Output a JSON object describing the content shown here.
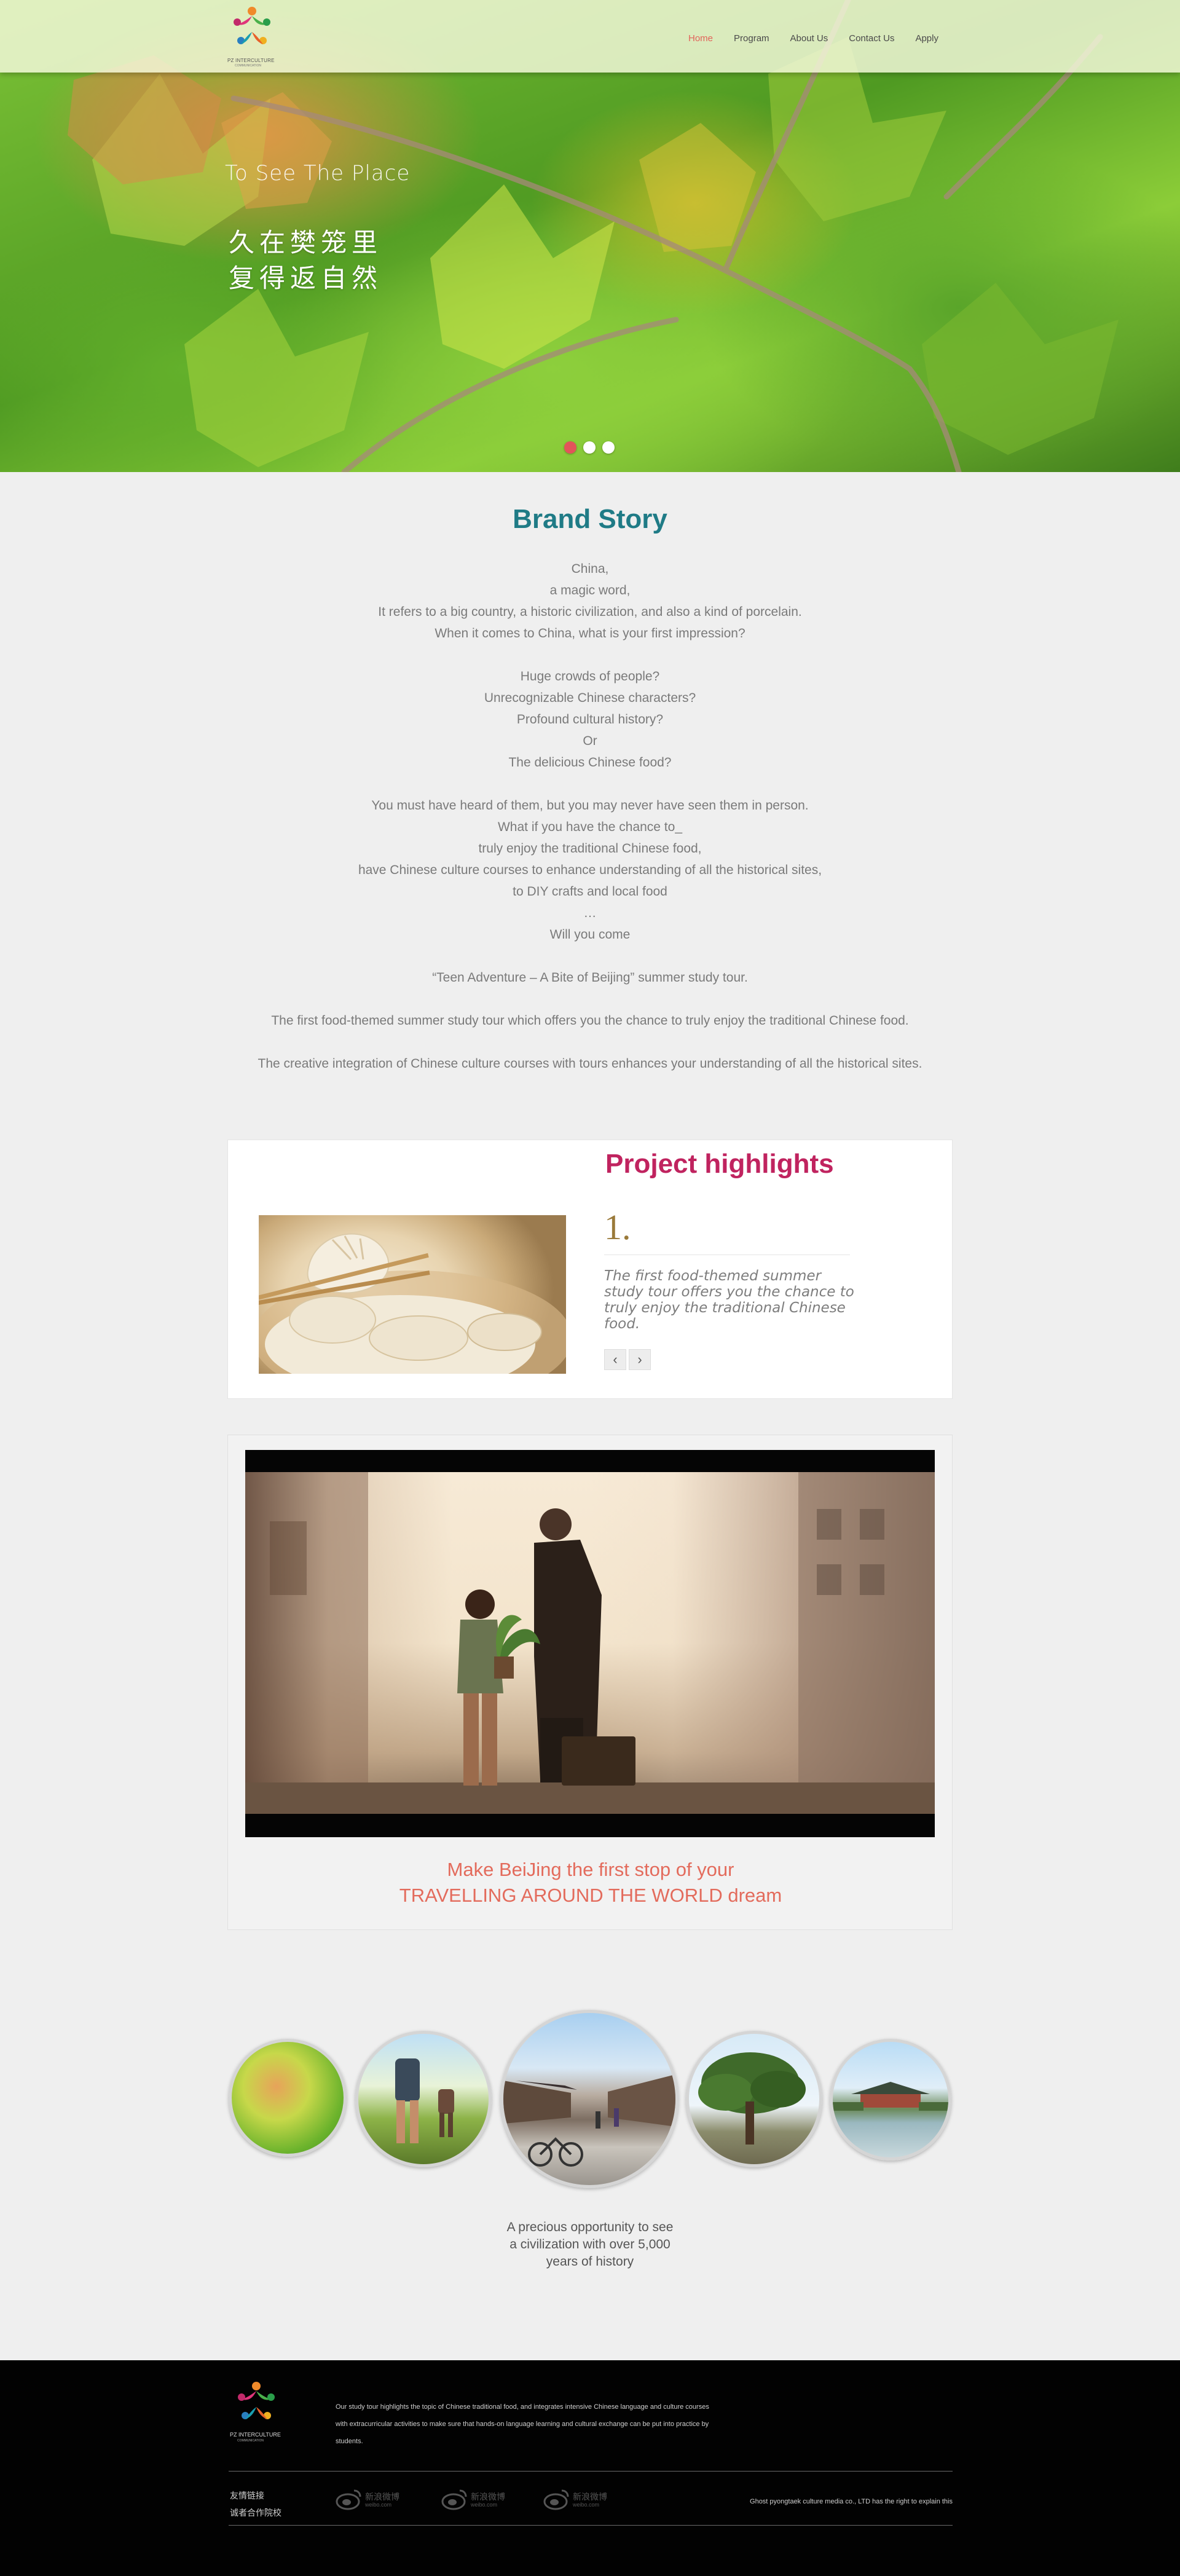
{
  "header": {
    "logo_text": "PZ INTERCULTURE",
    "logo_subtext": "COMMUNICATION",
    "nav": [
      {
        "label": "Home",
        "active": true
      },
      {
        "label": "Program",
        "active": false
      },
      {
        "label": "About Us",
        "active": false
      },
      {
        "label": "Contact Us",
        "active": false
      },
      {
        "label": "Apply",
        "active": false
      }
    ],
    "accent_color": "#e2645a"
  },
  "hero": {
    "subtitle": "To See The Place",
    "title_line1": "久在樊笼里",
    "title_line2": "复得返自然",
    "slides": 3,
    "active_slide": 1
  },
  "brand_story": {
    "title": "Brand Story",
    "lines": [
      "China,",
      "a magic word,",
      "It refers to a big country, a historic civilization, and also a kind of porcelain.",
      "When it comes to China, what is your first impression?",
      "",
      "Huge crowds of people?",
      "Unrecognizable Chinese characters?",
      "Profound cultural history?",
      "Or",
      "The delicious Chinese food?",
      "",
      "You must have heard of them, but you may never have seen them in person.",
      "What if you have the chance to_",
      "truly enjoy the traditional Chinese food,",
      "have Chinese culture courses to enhance understanding of all the historical sites,",
      "to DIY crafts and local food",
      "…",
      "Will you come",
      "",
      "“Teen Adventure – A Bite of Beijing” summer study tour.",
      "",
      "The first food-themed summer study tour which offers you the chance to truly enjoy the traditional Chinese food.",
      "",
      "The creative integration of Chinese culture courses with tours enhances your understanding of all the historical sites."
    ]
  },
  "highlights": {
    "title": "Project highlights",
    "number": "1.",
    "text": "The first food-themed summer study tour offers you the chance to truly enjoy the traditional Chinese food.",
    "prev_label": "‹",
    "next_label": "›"
  },
  "video": {
    "caption_line1": "Make BeiJing the first stop of your",
    "caption_line2": "TRAVELLING AROUND THE WORLD dream"
  },
  "gallery": {
    "images": [
      "leaves-photo",
      "hikers-photo",
      "hutong-street-photo",
      "tree-photo",
      "lake-pavilion-photo"
    ],
    "caption_line1": "A precious opportunity to see",
    "caption_line2": "a civilization with over 5,000",
    "caption_line3": "years of history"
  },
  "footer": {
    "logo_text": "PZ INTERCULTURE",
    "logo_subtext": "COMMUNICATION",
    "description": "Our study tour highlights the topic of Chinese traditional food, and integrates intensive Chinese language and culture courses with extracurricular activities to make sure that hands-on language learning and cultural exchange can be put into practice by students.",
    "links": [
      "友情链接",
      "诚者合作院校"
    ],
    "weibo": [
      {
        "cn": "新浪微博",
        "en": "weibo.com"
      },
      {
        "cn": "新浪微博",
        "en": "weibo.com"
      },
      {
        "cn": "新浪微博",
        "en": "weibo.com"
      }
    ],
    "copyright": "Ghost pyongtaek culture media co., LTD has the right to explain this"
  }
}
